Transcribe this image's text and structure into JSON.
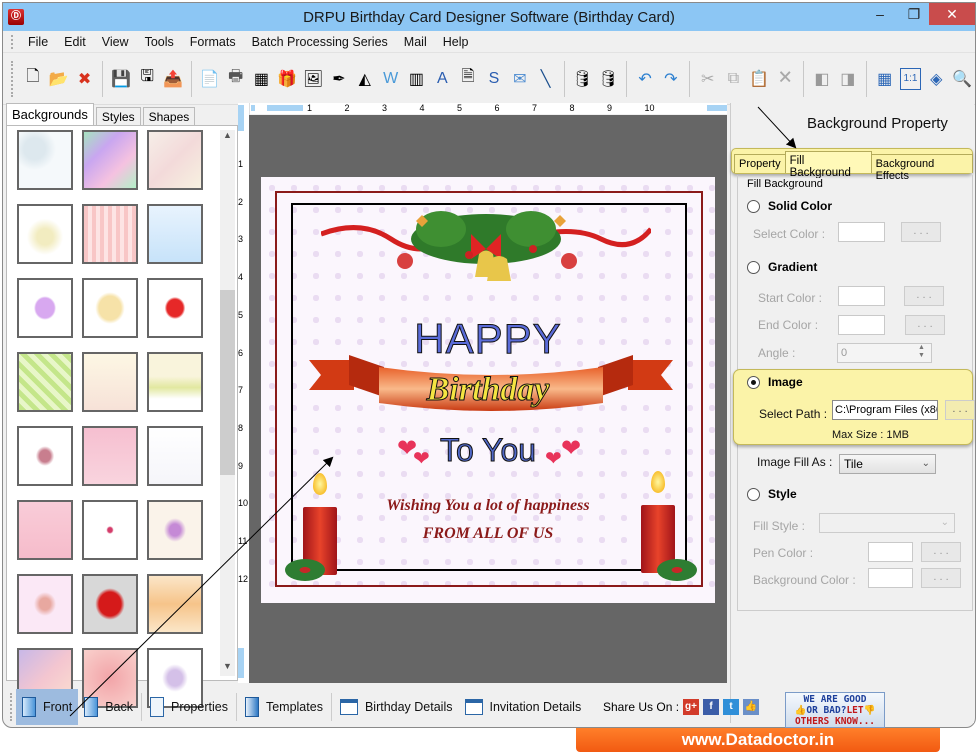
{
  "window": {
    "title": "DRPU Birthday Card Designer Software (Birthday Card)",
    "app_icon": "app-logo-icon",
    "controls": {
      "minimize": "–",
      "maximize": "❐",
      "close": "✕"
    }
  },
  "menu": [
    "File",
    "Edit",
    "View",
    "Tools",
    "Formats",
    "Batch Processing Series",
    "Mail",
    "Help"
  ],
  "toolbar": {
    "groups": [
      [
        {
          "icon": "new-icon",
          "glyph": "🗋"
        },
        {
          "icon": "open-icon",
          "glyph": "📂"
        },
        {
          "icon": "close-file-icon",
          "glyph": "✖"
        }
      ],
      [
        {
          "icon": "save-icon",
          "glyph": "💾"
        },
        {
          "icon": "save-as-icon",
          "glyph": "🖫"
        },
        {
          "icon": "export-icon",
          "glyph": "📤"
        }
      ],
      [
        {
          "icon": "properties-icon",
          "glyph": "📄"
        },
        {
          "icon": "print-icon",
          "glyph": "🖶"
        },
        {
          "icon": "background-icon",
          "glyph": "▦"
        },
        {
          "icon": "gift-icon",
          "glyph": "🎁"
        },
        {
          "icon": "insert-image-icon",
          "glyph": "🖼"
        },
        {
          "icon": "pen-icon",
          "glyph": "✒"
        },
        {
          "icon": "shapes-icon",
          "glyph": "◭"
        },
        {
          "icon": "watermark-icon",
          "glyph": "W"
        },
        {
          "icon": "barcode-icon",
          "glyph": "▥"
        },
        {
          "icon": "text-icon",
          "glyph": "A"
        },
        {
          "icon": "text-document-icon",
          "glyph": "🗎"
        },
        {
          "icon": "signature-icon",
          "glyph": "S"
        },
        {
          "icon": "mail-icon",
          "glyph": "✉"
        },
        {
          "icon": "line-icon",
          "glyph": "╲"
        }
      ],
      [
        {
          "icon": "database-new-icon",
          "glyph": "🛢"
        },
        {
          "icon": "database-icon",
          "glyph": "🛢"
        }
      ],
      [
        {
          "icon": "undo-icon",
          "glyph": "↶"
        },
        {
          "icon": "redo-icon",
          "glyph": "↷"
        }
      ],
      [
        {
          "icon": "cut-icon",
          "glyph": "✂"
        },
        {
          "icon": "copy-icon",
          "glyph": "⧉"
        },
        {
          "icon": "paste-icon",
          "glyph": "📋"
        },
        {
          "icon": "delete-icon",
          "glyph": "🗙"
        }
      ],
      [
        {
          "icon": "bring-front-icon",
          "glyph": "◧"
        },
        {
          "icon": "send-back-icon",
          "glyph": "◨"
        }
      ],
      [
        {
          "icon": "grid-icon",
          "glyph": "▦"
        },
        {
          "icon": "actual-size-icon",
          "glyph": "1:1"
        },
        {
          "icon": "fit-window-icon",
          "glyph": "◈"
        },
        {
          "icon": "zoom-in-icon",
          "glyph": "🔍"
        }
      ]
    ]
  },
  "left_panel": {
    "tabs": [
      "Backgrounds",
      "Styles",
      "Shapes"
    ],
    "active_tab": "Backgrounds",
    "thumbnails": [
      {
        "name": "bubbles",
        "bg": "radial-gradient(circle at 30% 30%,#dde8ee 20%,#f5f9fb 40%)"
      },
      {
        "name": "rainbow-watercolor",
        "bg": "linear-gradient(135deg,#a6e3c0,#c9a6f0,#f5c2e0,#b3f0c8)"
      },
      {
        "name": "teddy",
        "bg": "linear-gradient(135deg,#f6eee8,#f3dada,#f7f1e0)"
      },
      {
        "name": "happy-birthday-text",
        "bg": "radial-gradient(circle at 50% 55%,#f2ecc0 20%,#fff 45%)"
      },
      {
        "name": "pink-hearts-stripes",
        "bg": "repeating-linear-gradient(90deg,#f8c6c6 0 4px,#fde4e4 4px 8px)"
      },
      {
        "name": "balloons",
        "bg": "linear-gradient(#e8f3fd,#c7e3fa)"
      },
      {
        "name": "colored-hearts",
        "bg": "radial-gradient(#d8a8f0 25%,#fff 30%)"
      },
      {
        "name": "balloon-bunches",
        "bg": "radial-gradient(#f6e2a8 30%,#fff 40%)"
      },
      {
        "name": "red-hearts",
        "bg": "radial-gradient(#e62828 22%,#fff 28%)"
      },
      {
        "name": "green-stripes",
        "bg": "repeating-linear-gradient(45deg,#c4e68a 0 5px,#e8f6c8 5px 10px)"
      },
      {
        "name": "cakes-cream",
        "bg": "linear-gradient(#fdf7e4,#f7e2d8)"
      },
      {
        "name": "confetti-flowers",
        "bg": "linear-gradient(#f9f4dc 40%,#e2e8a0 60%,#fff 80%)"
      },
      {
        "name": "pink-roses",
        "bg": "radial-gradient(#c87e8e 15%,#fff 25%)"
      },
      {
        "name": "pink-lace-hearts",
        "bg": "linear-gradient(#f6bfd0,#f9d4de)"
      },
      {
        "name": "party-hats",
        "bg": "linear-gradient(#fff,#f5f5fa)"
      },
      {
        "name": "pink-damask",
        "bg": "linear-gradient(#f9ccd8,#f6bccb)"
      },
      {
        "name": "sprinkles",
        "bg": "radial-gradient(#d43c6a 6%,#fff 10%)"
      },
      {
        "name": "purple-blossoms",
        "bg": "radial-gradient(#c58ad6 15%,#faf3ea 30%)"
      },
      {
        "name": "pink-cakes",
        "bg": "radial-gradient(#e8a8a0 15%,#fbe8f6 30%)"
      },
      {
        "name": "red-silver-hearts",
        "bg": "radial-gradient(#d51a1a 30%,#d8d8d8 40%)"
      },
      {
        "name": "birthday-balloons-banner",
        "bg": "linear-gradient(#fbe6c8,#f6c48a 50%,#fbe6c8)"
      },
      {
        "name": "pastel-hearts",
        "bg": "linear-gradient(135deg,#c8b8e8,#f4c6d0,#fbe0d0)"
      },
      {
        "name": "pink-rose-closeup",
        "bg": "radial-gradient(circle,#f2a4a8,#f9d0cc)"
      },
      {
        "name": "lilac-flowers",
        "bg": "radial-gradient(#d4c0e8 20%,#fff 35%)"
      }
    ]
  },
  "ruler": {
    "horizontal": [
      "1",
      "2",
      "3",
      "4",
      "5",
      "6",
      "7",
      "8",
      "9",
      "10"
    ],
    "vertical": [
      "1",
      "2",
      "3",
      "4",
      "5",
      "6",
      "7",
      "8",
      "9",
      "10",
      "11",
      "12"
    ]
  },
  "card": {
    "happy": "HAPPY",
    "birthday": "Birthday",
    "to_you": "To You",
    "wish": "Wishing You a lot of happiness",
    "from": "FROM ALL OF US"
  },
  "right_panel": {
    "title": "Background Property",
    "tabs": [
      "Property",
      "Fill Background",
      "Background Effects"
    ],
    "active_tab": "Fill Background",
    "group_label": "Fill Background",
    "solid": {
      "label": "Solid Color",
      "checked": false,
      "select_color_label": "Select Color :",
      "button": ". . ."
    },
    "gradient": {
      "label": "Gradient",
      "checked": false,
      "start_label": "Start Color :",
      "end_label": "End Color :",
      "angle_label": "Angle :",
      "angle_value": "0",
      "button": ". . ."
    },
    "image": {
      "label": "Image",
      "checked": true,
      "path_label": "Select Path :",
      "path_value": "C:\\Program Files (x86",
      "button": ". . .",
      "max_size": "Max Size : 1MB",
      "fill_as_label": "Image Fill As :",
      "fill_as_value": "Tile"
    },
    "style": {
      "label": "Style",
      "checked": false,
      "fill_style_label": "Fill Style :",
      "fill_style_value": "",
      "pen_color_label": "Pen Color :",
      "bg_color_label": "Background Color :",
      "button": ". . ."
    }
  },
  "bottom_bar": {
    "items": [
      {
        "label": "Front",
        "active": true
      },
      {
        "label": "Back",
        "active": false
      },
      {
        "label": "Properties",
        "active": false
      },
      {
        "label": "Templates",
        "active": false
      },
      {
        "label": "Birthday Details",
        "active": false
      },
      {
        "label": "Invitation Details",
        "active": false
      }
    ],
    "share_label": "Share Us On :",
    "social": [
      {
        "name": "google-plus-icon",
        "glyph": "g+",
        "color": "#d23b2a"
      },
      {
        "name": "facebook-icon",
        "glyph": "f",
        "color": "#3b5da8"
      },
      {
        "name": "twitter-icon",
        "glyph": "t",
        "color": "#2f8fd8"
      },
      {
        "name": "like-icon",
        "glyph": "👍",
        "color": "#6a8fc8"
      }
    ],
    "rating_banner": {
      "line1": "WE ARE GOOD",
      "line2a": "OR BAD?",
      "line2b": "LET",
      "line3": "OTHERS KNOW..."
    }
  },
  "footer_banner": "www.Datadoctor.in"
}
